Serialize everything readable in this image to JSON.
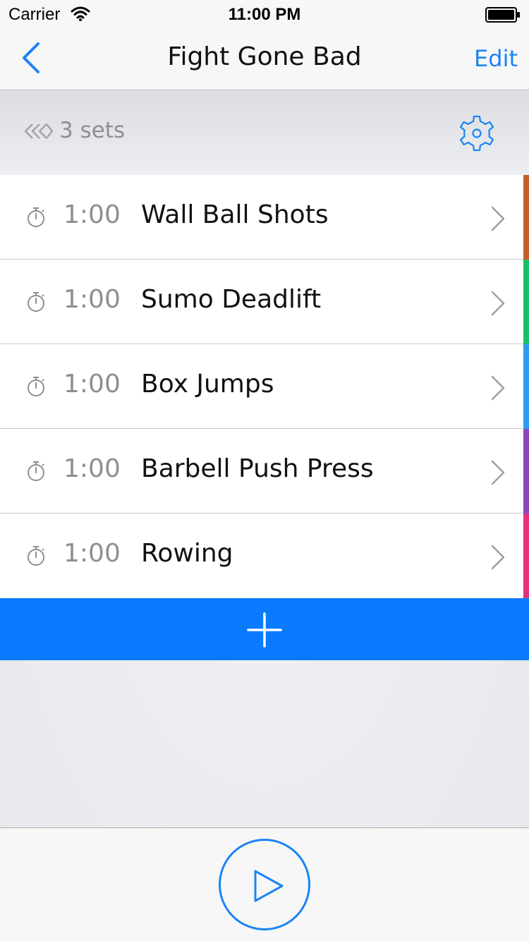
{
  "status_bar": {
    "carrier": "Carrier",
    "time": "11:00 PM",
    "wifi_icon": "wifi-icon",
    "battery_icon": "battery-full-icon"
  },
  "nav": {
    "title": "Fight Gone Bad",
    "back_icon": "chevron-left-icon",
    "edit_label": "Edit"
  },
  "sets": {
    "label": "3 sets",
    "icon": "chevrons-left-icon",
    "settings_icon": "gear-icon"
  },
  "exercises": [
    {
      "duration": "1:00",
      "name": "Wall Ball Shots",
      "color": "#c2602a"
    },
    {
      "duration": "1:00",
      "name": "Sumo Deadlift",
      "color": "#1cbc6a"
    },
    {
      "duration": "1:00",
      "name": "Box Jumps",
      "color": "#2b9cf2"
    },
    {
      "duration": "1:00",
      "name": "Barbell Push Press",
      "color": "#8a47c0"
    },
    {
      "duration": "1:00",
      "name": "Rowing",
      "color": "#e2347a"
    }
  ],
  "add_button": {
    "icon": "plus-icon"
  },
  "toolbar": {
    "play_icon": "play-icon"
  },
  "colors": {
    "accent": "#1a84f5",
    "add_bar": "#0a7bff",
    "secondary_text": "#8e8e93"
  }
}
